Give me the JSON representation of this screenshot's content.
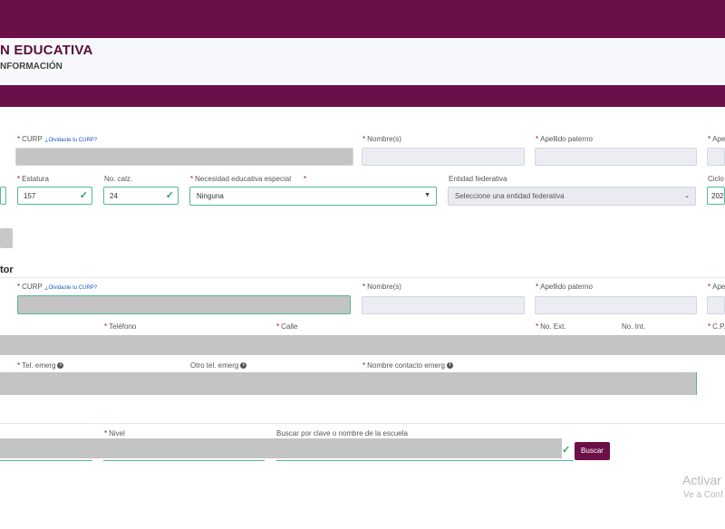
{
  "header": {
    "title": "N EDUCATIVA",
    "subtitle": "NFORMACIÓN"
  },
  "student": {
    "curp_label": "CURP",
    "curp_link": "¿Olvidaste tu CURP?",
    "nombre_label": "Nombre(s)",
    "apellido_paterno_label": "Apellido paterno",
    "apellido_materno_label_partial": "Ape",
    "estatura_label": "Estatura",
    "estatura_value": "157",
    "no_calz_label": "No. calz.",
    "no_calz_value": "24",
    "necesidad_label": "Necesidad educativa especial",
    "necesidad_value": "Ninguna",
    "entidad_label": "Entidad federativa",
    "entidad_placeholder": "Seleccione una entidad federativa",
    "ciclo_label_partial": "Ciclo",
    "ciclo_value_partial": "202"
  },
  "tutor": {
    "section_title_partial": "tor",
    "curp_label": "CURP",
    "curp_link": "¿Olvidaste tu CURP?",
    "nombre_label": "Nombre(s)",
    "apellido_paterno_label": "Apellido paterno",
    "apellido_materno_label_partial": "Ape",
    "telefono_label": "Teléfono",
    "calle_label": "Calle",
    "no_ext_label": "No. Ext.",
    "no_int_label": "No. Int.",
    "cp_label_partial": "C.P.",
    "tel_emerg_label": "Tel. emerg",
    "otro_tel_emerg_label": "Otro tel. emerg",
    "nombre_contacto_label": "Nombre contacto emerg",
    "info_glyph": "i"
  },
  "school": {
    "nivel_label": "Nivel",
    "buscar_label": "Buscar por clave o nombre de la escuela",
    "buscar_button": "Buscar"
  },
  "watermark": {
    "line1": "Activar",
    "line2": "Ve a Conf"
  },
  "colors": {
    "brand": "#6b0f48",
    "valid": "#2e9e6f",
    "required": "#b0002a",
    "link": "#1a56c4"
  }
}
